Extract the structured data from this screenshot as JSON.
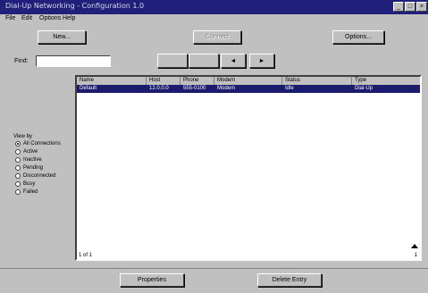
{
  "window": {
    "title": "Dial-Up Networking - Configuration 1.0",
    "min_glyph": "_",
    "max_glyph": "□",
    "close_glyph": "×"
  },
  "menu": [
    "File",
    "Edit",
    "Options",
    "Help"
  ],
  "toolbar": {
    "new_label": "New...",
    "center_label": "Connect",
    "options_label": "Options..."
  },
  "search": {
    "label": "Find:",
    "value": "",
    "placeholder": ""
  },
  "nav": {
    "first_label": "",
    "second_label": "",
    "prev_label": "◄",
    "next_label": "►"
  },
  "list": {
    "columns": [
      "Name",
      "Host",
      "Phone",
      "Modem",
      "Status",
      "Type"
    ],
    "rows": [
      [
        "Default",
        "12.0.0.0",
        "555-0100",
        "Modem",
        "Idle",
        "Dial-Up"
      ]
    ],
    "status_left": "1 of 1",
    "status_right": "1"
  },
  "filter": {
    "title": "View by",
    "options": [
      {
        "label": "All Connections",
        "checked": true
      },
      {
        "label": "Active",
        "checked": false
      },
      {
        "label": "Inactive",
        "checked": false
      },
      {
        "label": "Pending",
        "checked": false
      },
      {
        "label": "Disconnected",
        "checked": false
      },
      {
        "label": "Busy",
        "checked": false
      },
      {
        "label": "Failed",
        "checked": false
      }
    ]
  },
  "footer": {
    "left_label": "Properties",
    "right_label": "Delete Entry"
  }
}
